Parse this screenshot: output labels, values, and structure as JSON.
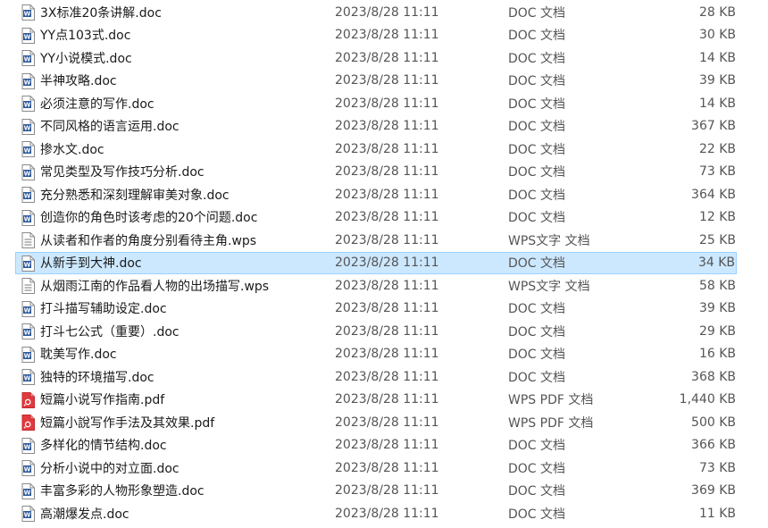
{
  "files": [
    {
      "name": "3X标准20条讲解.doc",
      "date": "2023/8/28 11:11",
      "type": "DOC 文档",
      "size": "28 KB",
      "icon": "word-doc-icon"
    },
    {
      "name": "YY点103式.doc",
      "date": "2023/8/28 11:11",
      "type": "DOC 文档",
      "size": "30 KB",
      "icon": "word-doc-icon"
    },
    {
      "name": "YY小说模式.doc",
      "date": "2023/8/28 11:11",
      "type": "DOC 文档",
      "size": "14 KB",
      "icon": "word-doc-icon"
    },
    {
      "name": "半神攻略.doc",
      "date": "2023/8/28 11:11",
      "type": "DOC 文档",
      "size": "39 KB",
      "icon": "word-doc-icon"
    },
    {
      "name": "必须注意的写作.doc",
      "date": "2023/8/28 11:11",
      "type": "DOC 文档",
      "size": "14 KB",
      "icon": "word-doc-icon"
    },
    {
      "name": "不同风格的语言运用.doc",
      "date": "2023/8/28 11:11",
      "type": "DOC 文档",
      "size": "367 KB",
      "icon": "word-doc-icon"
    },
    {
      "name": "掺水文.doc",
      "date": "2023/8/28 11:11",
      "type": "DOC 文档",
      "size": "22 KB",
      "icon": "word-doc-icon"
    },
    {
      "name": "常见类型及写作技巧分析.doc",
      "date": "2023/8/28 11:11",
      "type": "DOC 文档",
      "size": "73 KB",
      "icon": "word-doc-icon"
    },
    {
      "name": "充分熟悉和深刻理解审美对象.doc",
      "date": "2023/8/28 11:11",
      "type": "DOC 文档",
      "size": "364 KB",
      "icon": "word-doc-icon"
    },
    {
      "name": "创造你的角色时该考虑的20个问题.doc",
      "date": "2023/8/28 11:11",
      "type": "DOC 文档",
      "size": "12 KB",
      "icon": "word-doc-icon"
    },
    {
      "name": "从读者和作者的角度分别看待主角.wps",
      "date": "2023/8/28 11:11",
      "type": "WPS文字 文档",
      "size": "25 KB",
      "icon": "wps-doc-icon"
    },
    {
      "name": "从新手到大神.doc",
      "date": "2023/8/28 11:11",
      "type": "DOC 文档",
      "size": "34 KB",
      "icon": "word-doc-icon",
      "selected": true
    },
    {
      "name": "从烟雨江南的作品看人物的出场描写.wps",
      "date": "2023/8/28 11:11",
      "type": "WPS文字 文档",
      "size": "58 KB",
      "icon": "wps-doc-icon"
    },
    {
      "name": "打斗描写辅助设定.doc",
      "date": "2023/8/28 11:11",
      "type": "DOC 文档",
      "size": "39 KB",
      "icon": "word-doc-icon"
    },
    {
      "name": "打斗七公式（重要）.doc",
      "date": "2023/8/28 11:11",
      "type": "DOC 文档",
      "size": "29 KB",
      "icon": "word-doc-icon"
    },
    {
      "name": "耽美写作.doc",
      "date": "2023/8/28 11:11",
      "type": "DOC 文档",
      "size": "16 KB",
      "icon": "word-doc-icon"
    },
    {
      "name": "独特的环境描写.doc",
      "date": "2023/8/28 11:11",
      "type": "DOC 文档",
      "size": "368 KB",
      "icon": "word-doc-icon"
    },
    {
      "name": "短篇小说写作指南.pdf",
      "date": "2023/8/28 11:11",
      "type": "WPS PDF 文档",
      "size": "1,440 KB",
      "icon": "pdf-icon"
    },
    {
      "name": "短篇小說写作手法及其效果.pdf",
      "date": "2023/8/28 11:11",
      "type": "WPS PDF 文档",
      "size": "500 KB",
      "icon": "pdf-icon"
    },
    {
      "name": "多样化的情节结构.doc",
      "date": "2023/8/28 11:11",
      "type": "DOC 文档",
      "size": "366 KB",
      "icon": "word-doc-icon"
    },
    {
      "name": "分析小说中的对立面.doc",
      "date": "2023/8/28 11:11",
      "type": "DOC 文档",
      "size": "73 KB",
      "icon": "word-doc-icon"
    },
    {
      "name": "丰富多彩的人物形象塑造.doc",
      "date": "2023/8/28 11:11",
      "type": "DOC 文档",
      "size": "369 KB",
      "icon": "word-doc-icon"
    },
    {
      "name": "高潮爆发点.doc",
      "date": "2023/8/28 11:11",
      "type": "DOC 文档",
      "size": "11 KB",
      "icon": "word-doc-icon"
    }
  ],
  "colors": {
    "selection_bg": "#cce8ff",
    "selection_border": "#99d1ff",
    "word_blue": "#2b579a",
    "pdf_red": "#e0393e"
  }
}
